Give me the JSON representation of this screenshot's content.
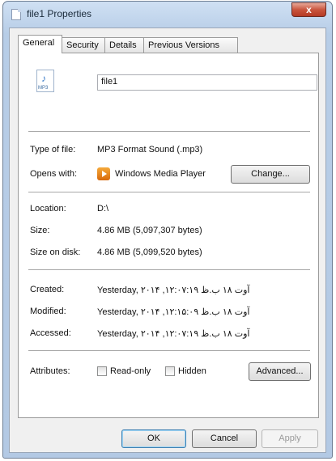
{
  "window": {
    "title": "file1 Properties",
    "close": "x"
  },
  "tabs": [
    "General",
    "Security",
    "Details",
    "Previous Versions"
  ],
  "file": {
    "name": "file1",
    "icon_label": "MP3"
  },
  "type": {
    "label": "Type of file:",
    "value": "MP3 Format Sound (.mp3)"
  },
  "opens": {
    "label": "Opens with:",
    "value": "Windows Media Player",
    "change": "Change..."
  },
  "location": {
    "label": "Location:",
    "value": "D:\\"
  },
  "size": {
    "label": "Size:",
    "value": "4.86 MB (5,097,307 bytes)"
  },
  "size_on_disk": {
    "label": "Size on disk:",
    "value": "4.86 MB (5,099,520 bytes)"
  },
  "created": {
    "label": "Created:",
    "value": "Yesterday, ۲۰۱۴ ,آوت ۱۸ ب.ظ ۱۲:۰۷:۱۹"
  },
  "modified": {
    "label": "Modified:",
    "value": "Yesterday, ۲۰۱۴ ,آوت ۱۸ ب.ظ ۱۲:۱۵:۰۹"
  },
  "accessed": {
    "label": "Accessed:",
    "value": "Yesterday, ۲۰۱۴ ,آوت ۱۸ ب.ظ ۱۲:۰۷:۱۹"
  },
  "attributes": {
    "label": "Attributes:",
    "readonly": "Read-only",
    "hidden": "Hidden",
    "advanced": "Advanced..."
  },
  "footer": {
    "ok": "OK",
    "cancel": "Cancel",
    "apply": "Apply"
  }
}
